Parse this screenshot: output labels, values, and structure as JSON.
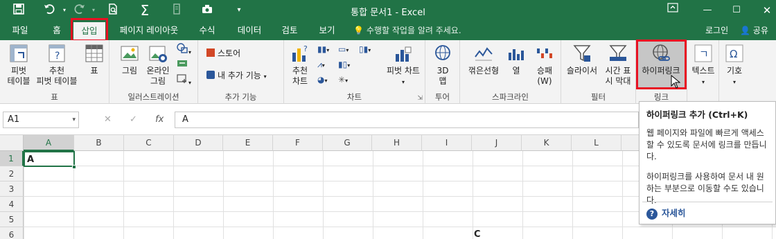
{
  "window": {
    "title": "통합 문서1 - Excel"
  },
  "tabs": [
    {
      "label": "파일"
    },
    {
      "label": "홈"
    },
    {
      "label": "삽입"
    },
    {
      "label": "페이지 레이아웃"
    },
    {
      "label": "수식"
    },
    {
      "label": "데이터"
    },
    {
      "label": "검토"
    },
    {
      "label": "보기"
    }
  ],
  "tell_me": {
    "placeholder": "수행할 작업을 알려 주세요."
  },
  "account": {
    "login": "로그인",
    "share": "공유"
  },
  "ribbon": {
    "groups": {
      "table": "표",
      "illustrations": "일러스트레이션",
      "addins": "추가 기능",
      "charts": "차트",
      "tours": "투어",
      "sparklines": "스파크라인",
      "filters": "필터",
      "links": "링크"
    },
    "buttons": {
      "pivot_table_1": "피벗",
      "pivot_table_2": "테이블",
      "rec_pivot_1": "추천",
      "rec_pivot_2": "피벗 테이블",
      "table": "표",
      "pictures": "그림",
      "online_pictures_1": "온라인",
      "online_pictures_2": "그림",
      "store": "스토어",
      "my_addins": "내 추가 기능",
      "rec_charts_1": "추천",
      "rec_charts_2": "차트",
      "pivot_chart": "피벗 차트",
      "map3d_1": "3D",
      "map3d_2": "맵",
      "line": "꺾은선형",
      "column": "열",
      "winloss_1": "승패",
      "winloss_2": "(W)",
      "slicer": "슬라이서",
      "timeline_1": "시간 표",
      "timeline_2": "시 막대",
      "hyperlink": "하이퍼링크",
      "text": "텍스트",
      "symbols": "기호"
    }
  },
  "formula_bar": {
    "name_box": "A1",
    "fx": "fx",
    "content": "A"
  },
  "grid": {
    "columns": [
      "A",
      "B",
      "C",
      "D",
      "E",
      "F",
      "G",
      "H",
      "I",
      "J",
      "K",
      "L"
    ],
    "rows": [
      "1",
      "2",
      "3",
      "4",
      "5",
      "6"
    ],
    "cell_a1": "A",
    "cell_j6": "C"
  },
  "tooltip": {
    "title": "하이퍼링크 추가 (Ctrl+K)",
    "body1": "웹 페이지와 파일에 빠르게 액세스할 수 있도록 문서에 링크를 만듭니다.",
    "body2": "하이퍼링크를 사용하여 문서 내 원하는 부분으로 이동할 수도 있습니다.",
    "more": "자세히"
  },
  "colors": {
    "excel_green": "#217346",
    "highlight_red": "#e81123",
    "link_blue": "#2b579a"
  }
}
